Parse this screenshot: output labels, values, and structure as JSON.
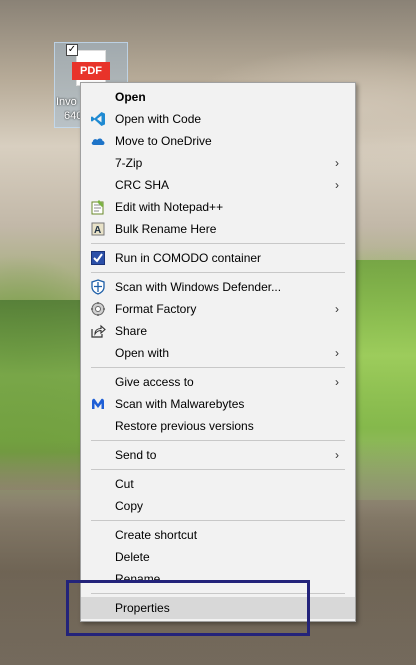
{
  "desktop": {
    "icon": {
      "badge": "PDF",
      "label_line1": "Invo",
      "label_line2": "640"
    }
  },
  "menu": {
    "items": [
      {
        "label": "Open",
        "icon": "none",
        "submenu": false,
        "bold": true
      },
      {
        "label": "Open with Code",
        "icon": "vscode-icon",
        "submenu": false
      },
      {
        "label": "Move to OneDrive",
        "icon": "onedrive-icon",
        "submenu": false
      },
      {
        "label": "7-Zip",
        "icon": "none",
        "submenu": true
      },
      {
        "label": "CRC SHA",
        "icon": "none",
        "submenu": true
      },
      {
        "label": "Edit with Notepad++",
        "icon": "notepadpp-icon",
        "submenu": false
      },
      {
        "label": "Bulk Rename Here",
        "icon": "bulk-rename-icon",
        "submenu": false
      },
      {
        "label": "Run in COMODO container",
        "icon": "comodo-icon",
        "submenu": false
      },
      {
        "label": "Scan with Windows Defender...",
        "icon": "defender-icon",
        "submenu": false
      },
      {
        "label": "Format Factory",
        "icon": "format-factory-icon",
        "submenu": true
      },
      {
        "label": "Share",
        "icon": "share-icon",
        "submenu": false
      },
      {
        "label": "Open with",
        "icon": "none",
        "submenu": true
      },
      {
        "label": "Give access to",
        "icon": "none",
        "submenu": true
      },
      {
        "label": "Scan with Malwarebytes",
        "icon": "malwarebytes-icon",
        "submenu": false
      },
      {
        "label": "Restore previous versions",
        "icon": "none",
        "submenu": false
      },
      {
        "label": "Send to",
        "icon": "none",
        "submenu": true
      },
      {
        "label": "Cut",
        "icon": "none",
        "submenu": false
      },
      {
        "label": "Copy",
        "icon": "none",
        "submenu": false
      },
      {
        "label": "Create shortcut",
        "icon": "none",
        "submenu": false
      },
      {
        "label": "Delete",
        "icon": "none",
        "submenu": false
      },
      {
        "label": "Rename",
        "icon": "none",
        "submenu": false
      },
      {
        "label": "Properties",
        "icon": "none",
        "submenu": false,
        "hovered": true
      }
    ],
    "submenu_arrow": "›"
  },
  "colors": {
    "menu_bg": "#f2f2f2",
    "hover_bg": "#d8d8d8",
    "highlight_border": "#23237a",
    "pdf_red": "#e8332a"
  }
}
